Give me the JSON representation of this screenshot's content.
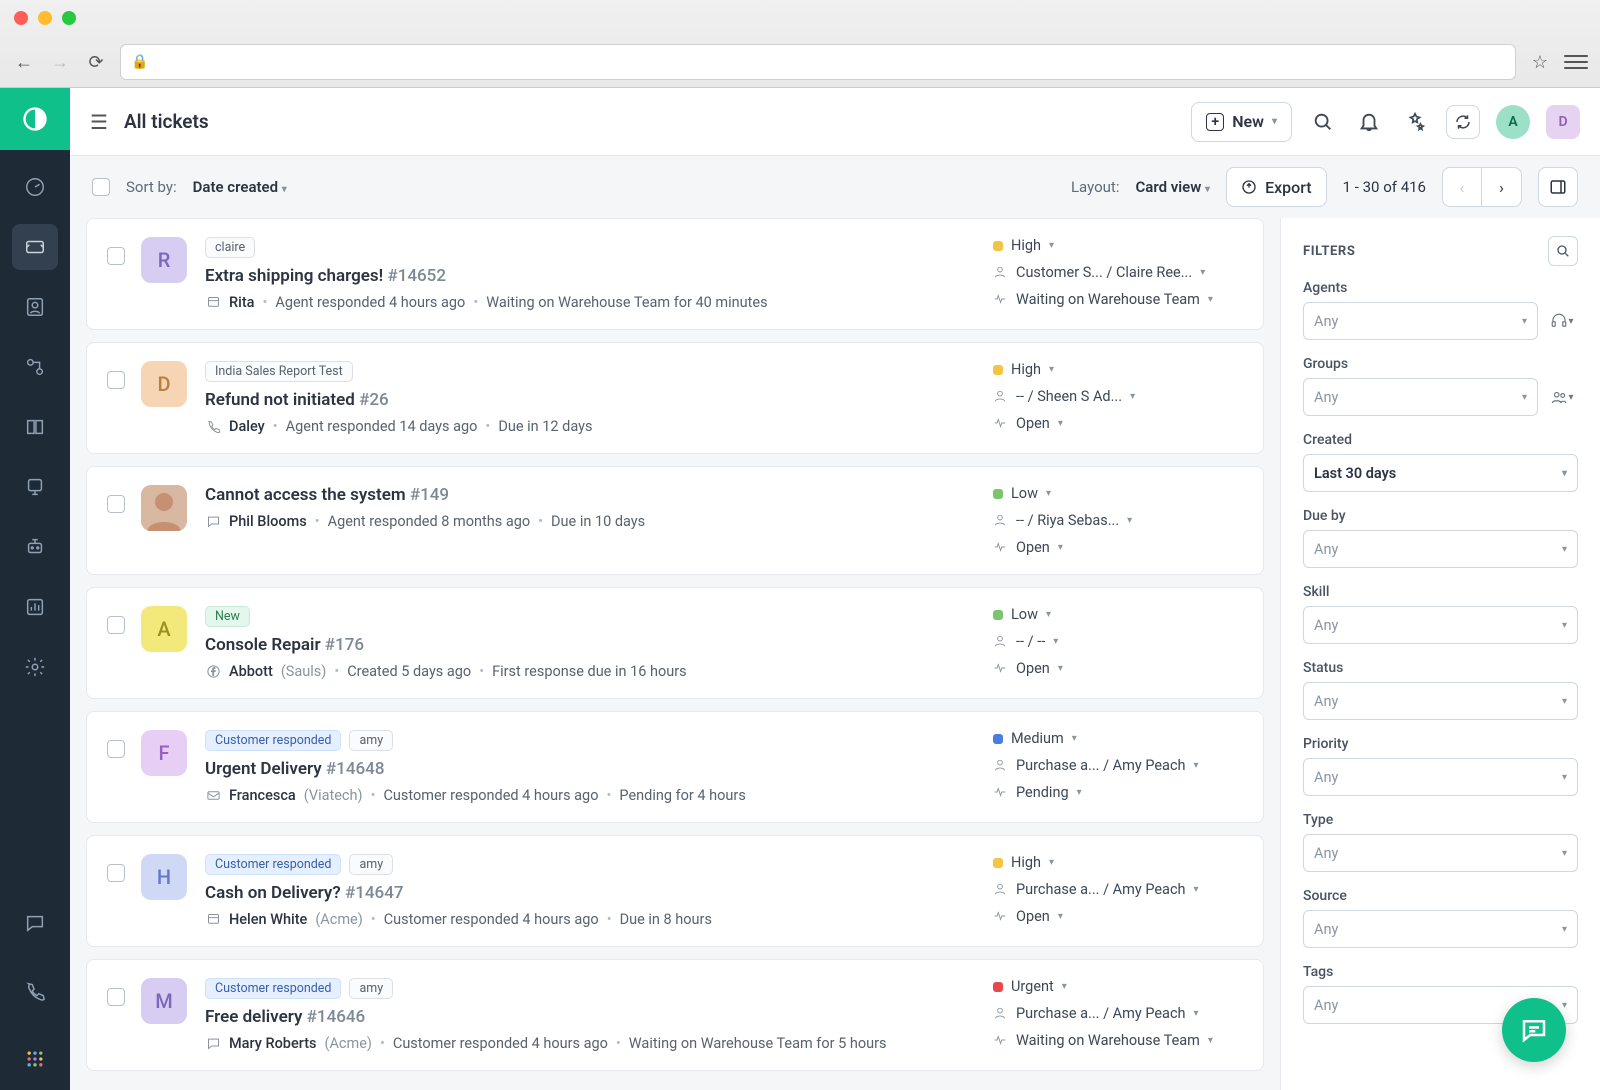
{
  "header": {
    "title": "All tickets",
    "new_label": "New",
    "avatar1": "A",
    "avatar2": "D"
  },
  "toolbar": {
    "sort_label": "Sort by:",
    "sort_value": "Date created",
    "layout_label": "Layout:",
    "layout_value": "Card view",
    "export_label": "Export",
    "pager_text": "1 - 30 of 416"
  },
  "filters": {
    "title": "FILTERS",
    "groups": [
      {
        "label": "Agents",
        "value": "Any",
        "has_value": false,
        "extra_icon": "headset"
      },
      {
        "label": "Groups",
        "value": "Any",
        "has_value": false,
        "extra_icon": "people"
      },
      {
        "label": "Created",
        "value": "Last 30 days",
        "has_value": true
      },
      {
        "label": "Due by",
        "value": "Any",
        "has_value": false
      },
      {
        "label": "Skill",
        "value": "Any",
        "has_value": false
      },
      {
        "label": "Status",
        "value": "Any",
        "has_value": false
      },
      {
        "label": "Priority",
        "value": "Any",
        "has_value": false
      },
      {
        "label": "Type",
        "value": "Any",
        "has_value": false
      },
      {
        "label": "Source",
        "value": "Any",
        "has_value": false
      },
      {
        "label": "Tags",
        "value": "Any",
        "has_value": false
      }
    ]
  },
  "tickets": [
    {
      "avatar": {
        "text": "R",
        "bg": "#d7cdf3",
        "color": "#7d68b8"
      },
      "tags": [
        {
          "text": "claire",
          "style": "plain"
        }
      ],
      "subject": "Extra shipping charges!",
      "id": "#14652",
      "requester": "Rita",
      "company": "",
      "activity": "Agent responded 4 hours ago",
      "due": "Waiting on Warehouse Team for 40 minutes",
      "channel": "portal",
      "priority": {
        "label": "High",
        "color": "#f4c542"
      },
      "assignee": "Customer S... / Claire Ree...",
      "status": "Waiting on Warehouse Team"
    },
    {
      "avatar": {
        "text": "D",
        "bg": "#f6d5b4",
        "color": "#b97f3f"
      },
      "tags": [
        {
          "text": "India Sales Report Test",
          "style": "plain"
        }
      ],
      "subject": "Refund not initiated",
      "id": "#26",
      "requester": "Daley",
      "company": "",
      "activity": "Agent responded 14 days ago",
      "due": "Due in 12 days",
      "channel": "phone",
      "priority": {
        "label": "High",
        "color": "#f4c542"
      },
      "assignee": "-- / Sheen S Ad...",
      "status": "Open"
    },
    {
      "avatar": {
        "text": "",
        "bg": "#e0e0e0",
        "color": "#666",
        "photo": true
      },
      "tags": [],
      "subject": "Cannot access the system",
      "id": "#149",
      "requester": "Phil Blooms",
      "company": "",
      "activity": "Agent responded 8 months ago",
      "due": "Due in 10 days",
      "channel": "chat",
      "priority": {
        "label": "Low",
        "color": "#7bc66c"
      },
      "assignee": "-- / Riya Sebas...",
      "status": "Open"
    },
    {
      "avatar": {
        "text": "A",
        "bg": "#f3e97a",
        "color": "#9a8f1f"
      },
      "tags": [
        {
          "text": "New",
          "style": "green"
        }
      ],
      "subject": "Console Repair",
      "id": "#176",
      "requester": "Abbott",
      "company": "(Sauls)",
      "activity": "Created 5 days ago",
      "due": "First response due in 16 hours",
      "channel": "facebook",
      "priority": {
        "label": "Low",
        "color": "#7bc66c"
      },
      "assignee": "-- / --",
      "status": "Open"
    },
    {
      "avatar": {
        "text": "F",
        "bg": "#e6cef5",
        "color": "#9a60c1"
      },
      "tags": [
        {
          "text": "Customer responded",
          "style": "blue"
        },
        {
          "text": "amy",
          "style": "plain"
        }
      ],
      "subject": "Urgent Delivery",
      "id": "#14648",
      "requester": "Francesca",
      "company": "(Viatech)",
      "activity": "Customer responded 4 hours ago",
      "due": "Pending for 4 hours",
      "channel": "email",
      "priority": {
        "label": "Medium",
        "color": "#4a7de0"
      },
      "assignee": "Purchase a... / Amy Peach",
      "status": "Pending"
    },
    {
      "avatar": {
        "text": "H",
        "bg": "#cfd8f5",
        "color": "#6478c8"
      },
      "tags": [
        {
          "text": "Customer responded",
          "style": "blue"
        },
        {
          "text": "amy",
          "style": "plain"
        }
      ],
      "subject": "Cash on Delivery?",
      "id": "#14647",
      "requester": "Helen White",
      "company": "(Acme)",
      "activity": "Customer responded 4 hours ago",
      "due": "Due in 8 hours",
      "channel": "portal",
      "priority": {
        "label": "High",
        "color": "#f4c542"
      },
      "assignee": "Purchase a... / Amy Peach",
      "status": "Open"
    },
    {
      "avatar": {
        "text": "M",
        "bg": "#d7cdf3",
        "color": "#7d68b8"
      },
      "tags": [
        {
          "text": "Customer responded",
          "style": "blue"
        },
        {
          "text": "amy",
          "style": "plain"
        }
      ],
      "subject": "Free delivery",
      "id": "#14646",
      "requester": "Mary Roberts",
      "company": "(Acme)",
      "activity": "Customer responded 4 hours ago",
      "due": "Waiting on Warehouse Team for 5 hours",
      "channel": "chat",
      "priority": {
        "label": "Urgent",
        "color": "#e5484d"
      },
      "assignee": "Purchase a... / Amy Peach",
      "status": "Waiting on Warehouse Team"
    }
  ]
}
